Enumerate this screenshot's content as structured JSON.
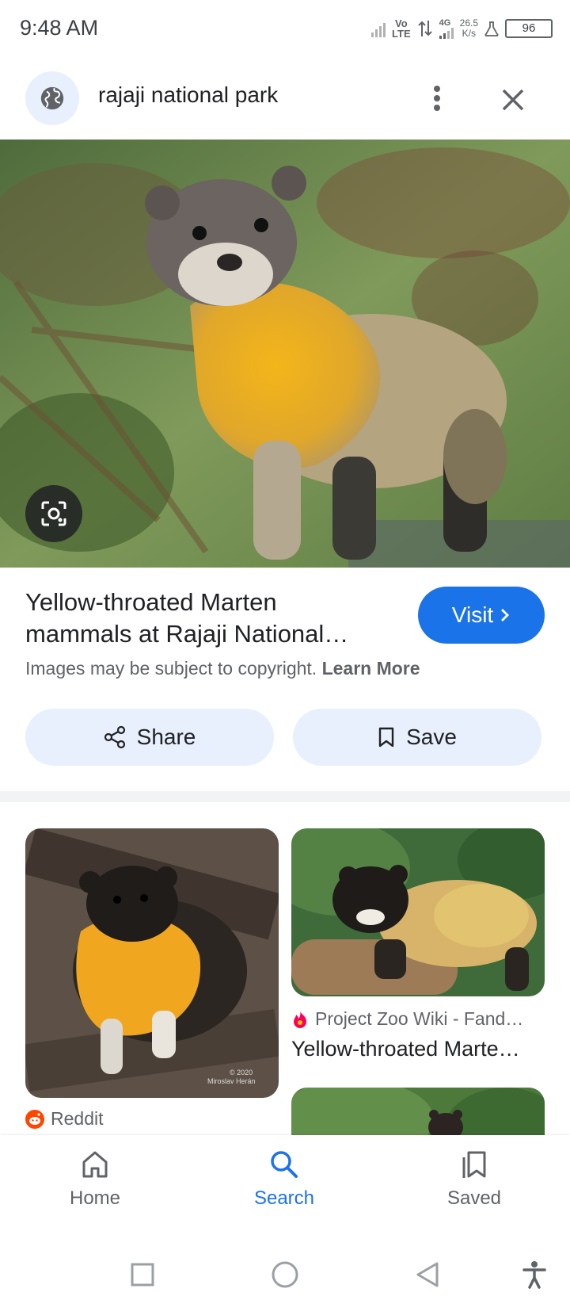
{
  "status_bar": {
    "time": "9:48 AM",
    "network_label_top": "Vo",
    "network_label_bottom": "LTE",
    "network_type": "4G",
    "speed_value": "26.5",
    "speed_unit": "K/s",
    "battery": "96"
  },
  "search": {
    "query": "rajaji national park"
  },
  "result": {
    "title": "Yellow-throated Marten mammals at Rajaji National…",
    "visit_label": "Visit",
    "copyright_text": "Images may be subject to copyright.",
    "learn_more": "Learn More",
    "share_label": "Share",
    "save_label": "Save"
  },
  "related": [
    {
      "source": "Reddit",
      "caption": "",
      "watermark_line1": "© 2020",
      "watermark_line2": "Miroslav Herán"
    },
    {
      "source": "Project Zoo Wiki - Fand…",
      "caption": "Yellow-throated Marte…"
    }
  ],
  "bottom_nav": {
    "items": [
      {
        "label": "Home",
        "icon": "home-icon",
        "active": false
      },
      {
        "label": "Search",
        "icon": "search-icon",
        "active": true
      },
      {
        "label": "Saved",
        "icon": "saved-icon",
        "active": false
      }
    ]
  },
  "colors": {
    "accent": "#1a73e8",
    "chip_bg": "#e8f0fe",
    "text_primary": "#202124",
    "text_secondary": "#5f6368"
  }
}
